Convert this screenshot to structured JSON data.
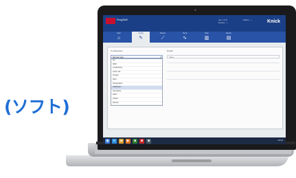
{
  "caption": "(ソフト)",
  "app": {
    "title_label": "ProgSoft",
    "brand": "Knick",
    "header_info": [
      "Ver. 1.0.0",
      "Device: ---",
      "Status: ---"
    ],
    "ribbon_tabs": [
      {
        "label": "Start",
        "icon": "home-icon",
        "glyph": "⌂",
        "active": false
      },
      {
        "label": "Config",
        "icon": "edit-icon",
        "glyph": "✎",
        "active": true
      },
      {
        "label": "Params",
        "icon": "pen-icon",
        "glyph": "⟋",
        "active": false
      },
      {
        "label": "Trend",
        "icon": "chart-icon",
        "glyph": "∿",
        "active": false
      },
      {
        "label": "Data",
        "icon": "bars-icon",
        "glyph": "▥",
        "active": false
      },
      {
        "label": "Report",
        "icon": "document-icon",
        "glyph": "▤",
        "active": false
      }
    ],
    "left_panel_title": "Configuration",
    "right_panel_title": "Details",
    "dropdown_value": "Sensor type",
    "dropdown_items": [
      "pH",
      "ORP",
      "Conductivity",
      "Cond. ind.",
      "Oxygen",
      "Flow",
      "Temperature",
      "Calibration",
      "Sensoface",
      "Alarm",
      "Output",
      "Service"
    ],
    "selected_index": 7,
    "right_field_value": "Value",
    "taskbar_icons": [
      {
        "icon": "start-icon",
        "glyph": "◉",
        "color": "#3a7bd5"
      },
      {
        "icon": "browser-icon",
        "glyph": "e",
        "color": "#2c8fd8"
      },
      {
        "icon": "folder-icon",
        "glyph": "▰",
        "color": "#d8a02c"
      },
      {
        "icon": "media-icon",
        "glyph": "▶",
        "color": "#e07020"
      },
      {
        "icon": "app-icon",
        "glyph": "■",
        "color": "#2e7d32"
      },
      {
        "icon": "app2-icon",
        "glyph": "■",
        "color": "#c62828"
      },
      {
        "icon": "app3-icon",
        "glyph": "■",
        "color": "#455a64"
      }
    ],
    "clock": "10:24"
  }
}
